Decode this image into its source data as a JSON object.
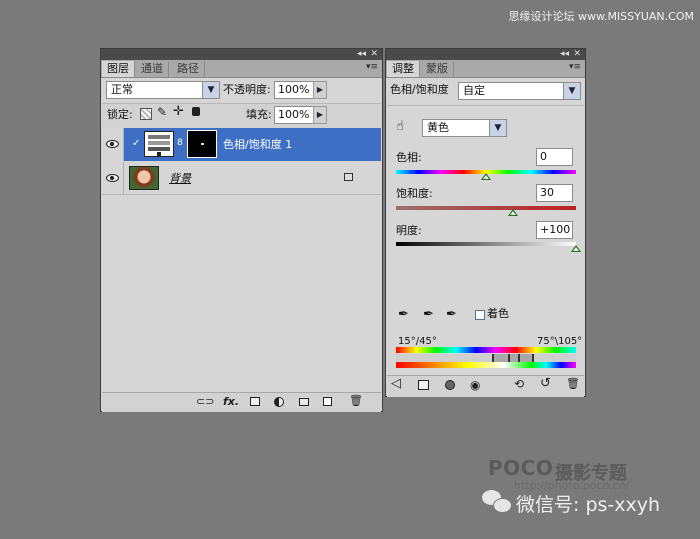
{
  "watermark_top": "思缘设计论坛 www.MISSYUAN.COM",
  "layers_panel": {
    "tabs": [
      "图层",
      "通道",
      "路径"
    ],
    "blend_mode": "正常",
    "opacity_label": "不透明度:",
    "opacity_value": "100%",
    "lock_label": "锁定:",
    "fill_label": "填充:",
    "fill_value": "100%",
    "layers": [
      {
        "name": "色相/饱和度 1",
        "selected": true
      },
      {
        "name": "背景",
        "selected": false
      }
    ],
    "footer_icons": [
      "link-icon",
      "fx-icon",
      "mask-icon",
      "adjustment-icon",
      "group-icon",
      "new-layer-icon",
      "trash-icon"
    ],
    "footer_fx_text": "fx."
  },
  "adjustments_panel": {
    "tabs": [
      "调整",
      "蒙版"
    ],
    "title": "色相/饱和度",
    "preset": "自定",
    "channel": "黄色",
    "hue_label": "色相:",
    "hue_value": "0",
    "saturation_label": "饱和度:",
    "saturation_value": "30",
    "lightness_label": "明度:",
    "lightness_value": "+100",
    "colorize_label": "着色",
    "range_left": "15°/45°",
    "range_right": "75°\\105°",
    "hue_position": 0.5,
    "saturation_position": 0.65,
    "lightness_position": 1.0
  },
  "watermark": {
    "logo": "POCO",
    "title": "摄影专题",
    "url": "http://photo.poco.cn/",
    "wechat": "微信号: ps-xxyh"
  },
  "colors": {
    "selection": "#3e6fc4",
    "panel_bg": "#d6d6d6",
    "canvas_bg": "#7a7a7a",
    "thumb": "#1f6e1f"
  }
}
